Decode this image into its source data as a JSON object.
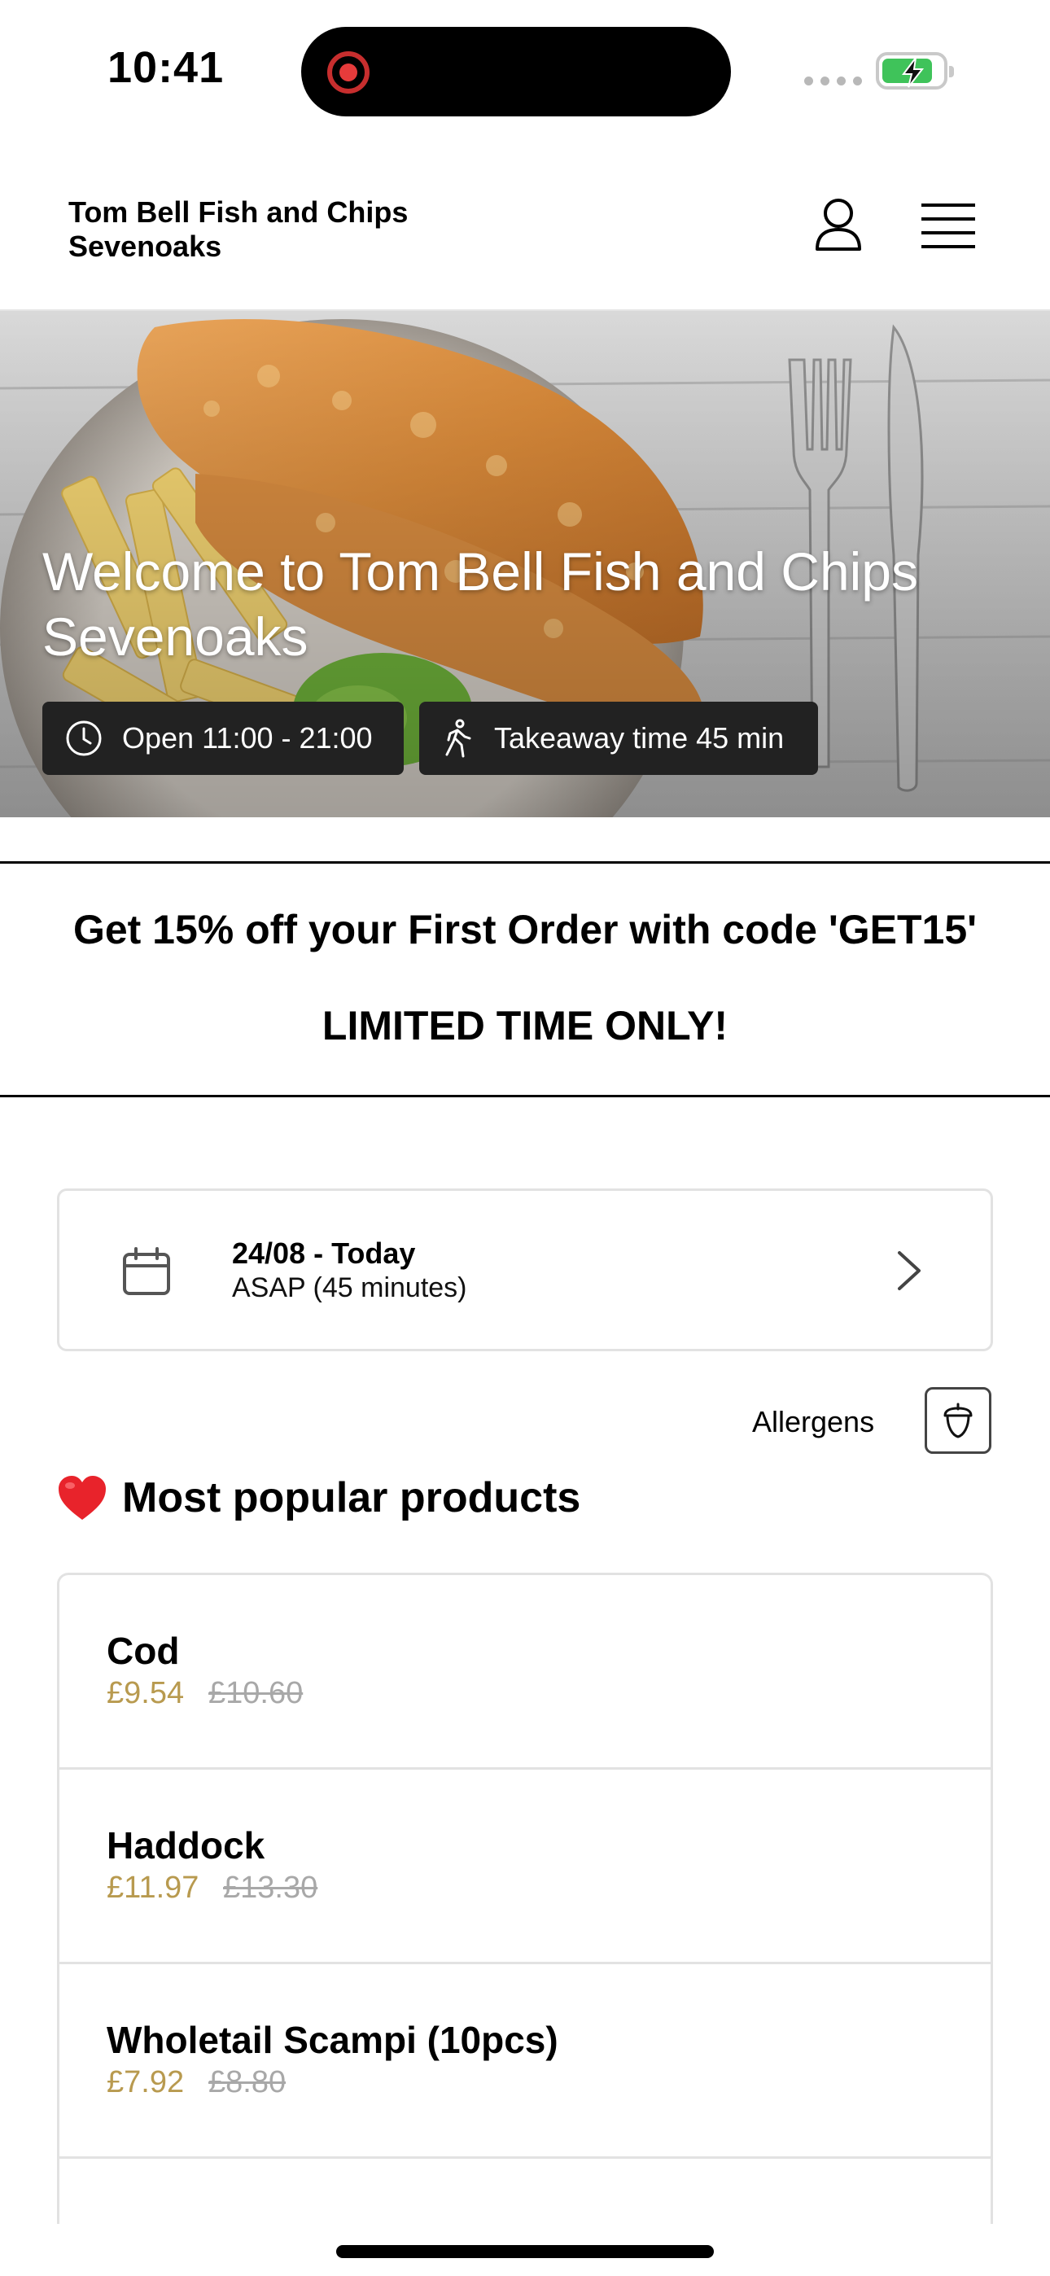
{
  "status_bar": {
    "time": "10:41",
    "battery_level_fraction": 0.85
  },
  "header": {
    "brand": "Tom Bell Fish and Chips Sevenoaks",
    "icons": [
      "user-icon",
      "menu-icon"
    ]
  },
  "hero": {
    "title": "Welcome to Tom Bell Fish and Chips Sevenoaks",
    "open_hours": "Open 11:00 - 21:00",
    "takeaway_time": "Takeaway time 45 min",
    "icons": [
      "clock-icon",
      "walking-icon"
    ]
  },
  "promo": {
    "line1": "Get 15% off your First Order with code 'GET15'",
    "line2": "LIMITED TIME ONLY!"
  },
  "date_selector": {
    "date": "24/08 - Today",
    "time": "ASAP (45 minutes)",
    "icons": [
      "calendar-icon",
      "chevron-right-icon"
    ]
  },
  "allergens": {
    "label": "Allergens",
    "icon": "acorn-icon"
  },
  "popular": {
    "title": "Most popular products",
    "icon": "heart-icon",
    "price_color": "#b89a4f",
    "products": [
      {
        "name": "Cod",
        "price": "£9.54",
        "old_price": "£10.60"
      },
      {
        "name": "Haddock",
        "price": "£11.97",
        "old_price": "£13.30"
      },
      {
        "name": "Wholetail Scampi (10pcs)",
        "price": "£7.92",
        "old_price": "£8.80"
      }
    ]
  }
}
